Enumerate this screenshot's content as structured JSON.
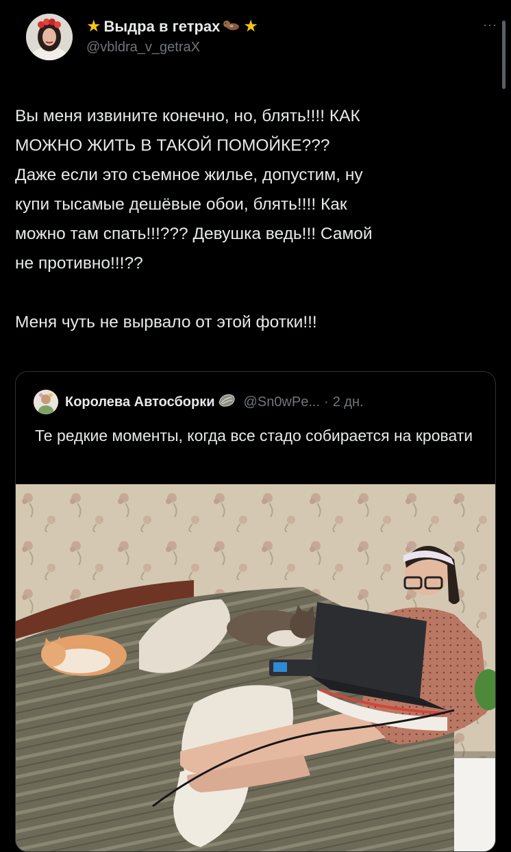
{
  "tweet": {
    "author_name": "Выдра в гетрах",
    "author_handle": "@vbldra_v_getraX",
    "more": "···",
    "text": "Вы меня извините конечно, но, блять!!!! КАК\nМОЖНО ЖИТЬ В ТАКОЙ ПОМОЙКЕ???\nДаже если это съемное жилье, допустим, ну\nкупи тысамые дешёвые обои, блять!!!! Как\nможно там спать!!!??? Девушка ведь!!! Самой\nне противно!!!??\n\nМеня чуть не вырвало от этой фотки!!!"
  },
  "quote": {
    "author_name": "Королева Автосборки",
    "author_handle": "@Sn0wPe...",
    "separator": "·",
    "time": "2 дн.",
    "text": "Те редкие моменты, когда все стадо собирается на кровати"
  },
  "colors": {
    "background": "#000000",
    "text_primary": "#e7e9ea",
    "text_secondary": "#71767b",
    "border": "#2f3336",
    "star": "#f5c518"
  }
}
